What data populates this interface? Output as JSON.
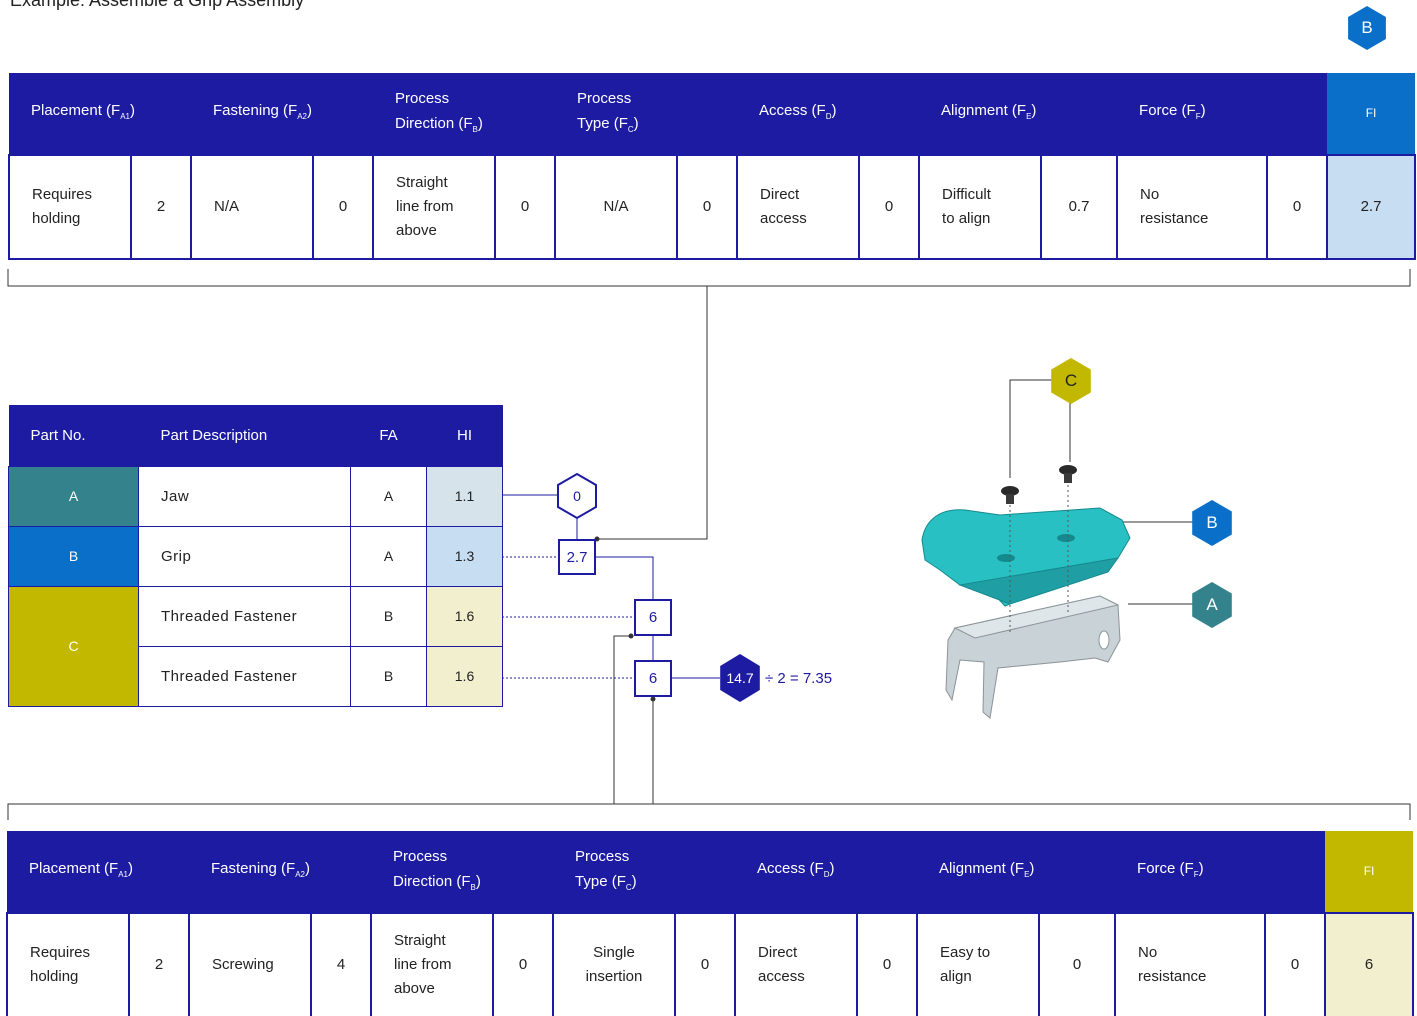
{
  "top_cut_text": "Example: Assemble a Grip Assembly",
  "hex_labels": {
    "a": "A",
    "b": "B",
    "c": "C"
  },
  "score_hex": {
    "zero": "0",
    "total": "14.7"
  },
  "colors": {
    "header_blue": "#1c1ba2",
    "part_a": "#34838c",
    "part_b": "#0a6fc8",
    "part_c": "#c2b800",
    "hi_a": "#d6e3ea",
    "hi_b": "#c7ddf2",
    "hi_c": "#f2efcf",
    "fi_top_bg": "#c7ddf2",
    "fi_bottom_bg": "#f2efcf"
  },
  "factor_headers": {
    "placement": "Placement (F",
    "placement_sub": "A1",
    "fastening": "Fastening (F",
    "fastening_sub": "A2",
    "process_dir_1": "Process",
    "process_dir_2": "Direction (F",
    "process_dir_sub": "B",
    "process_type_1": "Process",
    "process_type_2": "Type (F",
    "process_type_sub": "C",
    "access": "Access (F",
    "access_sub": "D",
    "alignment": "Alignment (F",
    "alignment_sub": "E",
    "force": "Force (F",
    "force_sub": "F",
    "close": ")",
    "fi": "FI"
  },
  "top_row": {
    "placement_1": "Requires",
    "placement_2": "holding",
    "placement_val": "2",
    "fastening": "N/A",
    "fastening_val": "0",
    "dir_1": "Straight",
    "dir_2": "line from",
    "dir_3": "above",
    "dir_val": "0",
    "type_1": "N/A",
    "type_2": "",
    "type_val": "0",
    "access_1": "Direct",
    "access_2": "access",
    "access_val": "0",
    "align_1": "Difficult",
    "align_2": "to align",
    "align_val": "0.7",
    "force_1": "No",
    "force_2": "resistance",
    "force_val": "0",
    "fi": "2.7"
  },
  "bottom_row": {
    "placement_1": "Requires",
    "placement_2": "holding",
    "placement_val": "2",
    "fastening": "Screwing",
    "fastening_val": "4",
    "dir_1": "Straight",
    "dir_2": "line from",
    "dir_3": "above",
    "dir_val": "0",
    "type_1": "Single",
    "type_2": "insertion",
    "type_val": "0",
    "access_1": "Direct",
    "access_2": "access",
    "access_val": "0",
    "align_1": "Easy to",
    "align_2": "align",
    "align_val": "0",
    "force_1": "No",
    "force_2": "resistance",
    "force_val": "0",
    "fi": "6"
  },
  "parts_table": {
    "headers": {
      "part_no": "Part No.",
      "desc": "Part Description",
      "fa": "FA",
      "hi": "HI"
    },
    "rows": [
      {
        "part_no": "A",
        "desc": "Jaw",
        "fa": "A",
        "hi": "1.1"
      },
      {
        "part_no": "B",
        "desc": "Grip",
        "fa": "A",
        "hi": "1.3"
      },
      {
        "part_no": "C",
        "desc": "Threaded Fastener",
        "fa": "B",
        "hi": "1.6"
      },
      {
        "part_no": "",
        "desc": "Threaded Fastener",
        "fa": "B",
        "hi": "1.6"
      }
    ]
  },
  "chain_boxes": {
    "b": "2.7",
    "c1": "6",
    "c2": "6"
  },
  "equation": "÷ 2 = 7.35"
}
